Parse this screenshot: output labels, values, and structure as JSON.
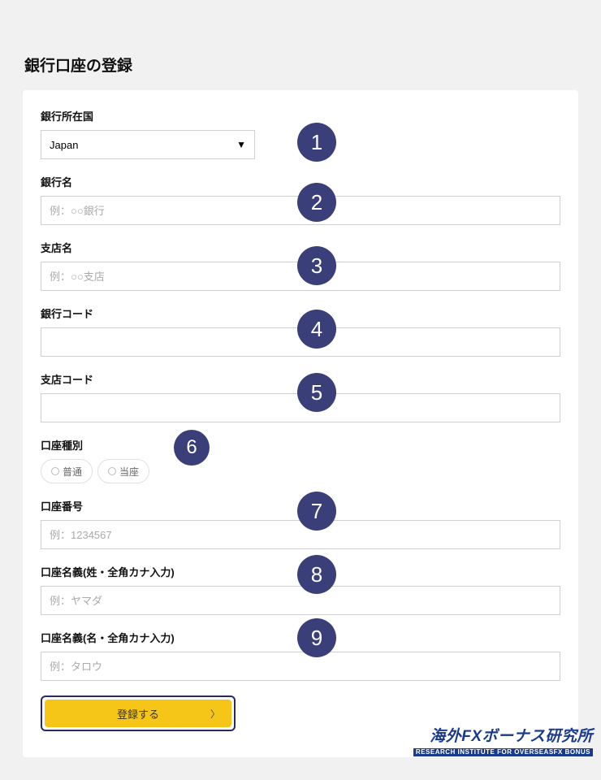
{
  "page": {
    "title": "銀行口座の登録"
  },
  "fields": {
    "country": {
      "label": "銀行所在国",
      "value": "Japan"
    },
    "bank_name": {
      "label": "銀行名",
      "placeholder": "例：○○銀行"
    },
    "branch_name": {
      "label": "支店名",
      "placeholder": "例：○○支店"
    },
    "bank_code": {
      "label": "銀行コード",
      "placeholder": ""
    },
    "branch_code": {
      "label": "支店コード",
      "placeholder": ""
    },
    "account_type": {
      "label": "口座種別"
    },
    "radio": {
      "option1": "普通",
      "option2": "当座"
    },
    "account_number": {
      "label": "口座番号",
      "placeholder": "例：1234567"
    },
    "holder_last": {
      "label": "口座名義(姓・全角カナ入力)",
      "placeholder": "例：ヤマダ"
    },
    "holder_first": {
      "label": "口座名義(名・全角カナ入力)",
      "placeholder": "例：タロウ"
    }
  },
  "submit": {
    "label": "登録する"
  },
  "badges": {
    "1": "1",
    "2": "2",
    "3": "3",
    "4": "4",
    "5": "5",
    "6": "6",
    "7": "7",
    "8": "8",
    "9": "9"
  },
  "footer": {
    "main": "海外FXボーナス研究所",
    "sub": "RESEARCH INSTITUTE FOR OVERSEASFX BONUS"
  }
}
